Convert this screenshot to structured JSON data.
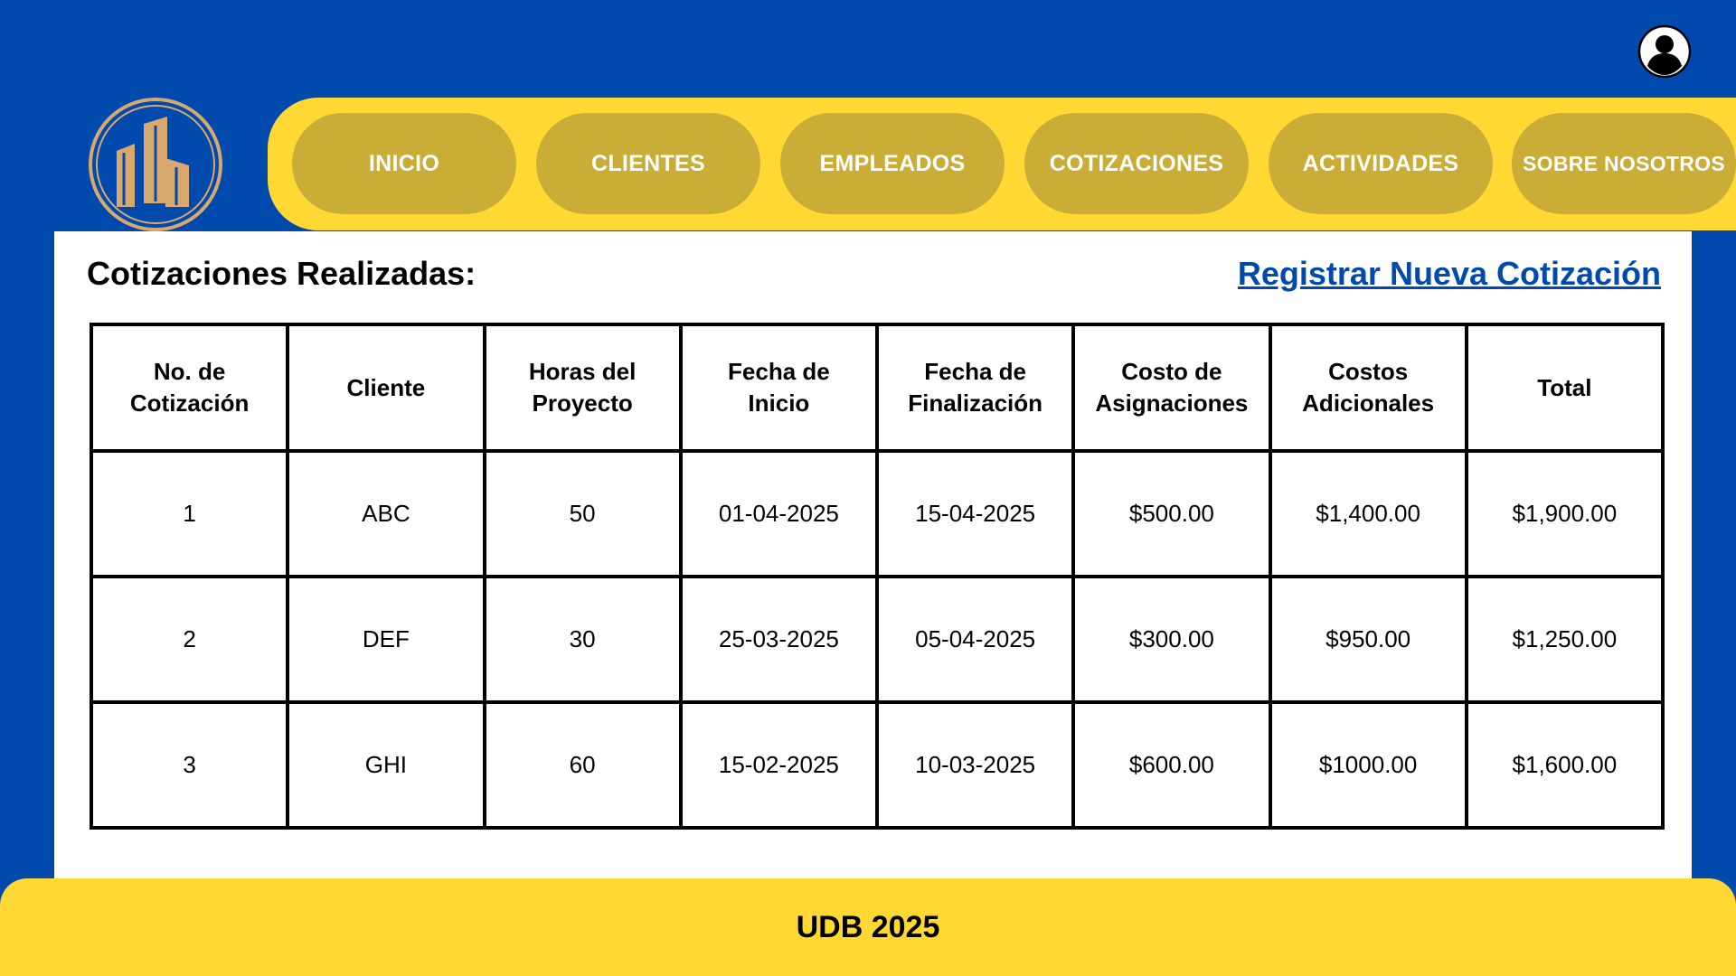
{
  "header": {
    "user_icon": "user-icon",
    "logo_icon": "building-logo-icon"
  },
  "nav": {
    "items": [
      {
        "label": "INICIO"
      },
      {
        "label": "CLIENTES"
      },
      {
        "label": "EMPLEADOS"
      },
      {
        "label": "COTIZACIONES"
      },
      {
        "label": "ACTIVIDADES"
      },
      {
        "label": "SOBRE NOSOTROS"
      }
    ]
  },
  "main": {
    "title": "Cotizaciones Realizadas:",
    "register_link": "Registrar Nueva Cotización"
  },
  "table": {
    "headers": [
      [
        "No. de",
        "Cotización"
      ],
      [
        "Cliente"
      ],
      [
        "Horas del",
        "Proyecto"
      ],
      [
        "Fecha de",
        "Inicio"
      ],
      [
        "Fecha de",
        "Finalización"
      ],
      [
        "Costo de",
        "Asignaciones"
      ],
      [
        "Costos",
        "Adicionales"
      ],
      [
        "Total"
      ]
    ],
    "rows": [
      [
        "1",
        "ABC",
        "50",
        "01-04-2025",
        "15-04-2025",
        "$500.00",
        "$1,400.00",
        "$1,900.00"
      ],
      [
        "2",
        "DEF",
        "30",
        "25-03-2025",
        "05-04-2025",
        "$300.00",
        "$950.00",
        "$1,250.00"
      ],
      [
        "3",
        "GHI",
        "60",
        "15-02-2025",
        "10-03-2025",
        "$600.00",
        "$1000.00",
        "$1,600.00"
      ]
    ]
  },
  "footer": {
    "text": "UDB 2025"
  },
  "colors": {
    "primary_blue": "#004aad",
    "accent_yellow": "#ffd833",
    "nav_button": "#c9ad36",
    "logo_gold": "#d9a86c"
  }
}
